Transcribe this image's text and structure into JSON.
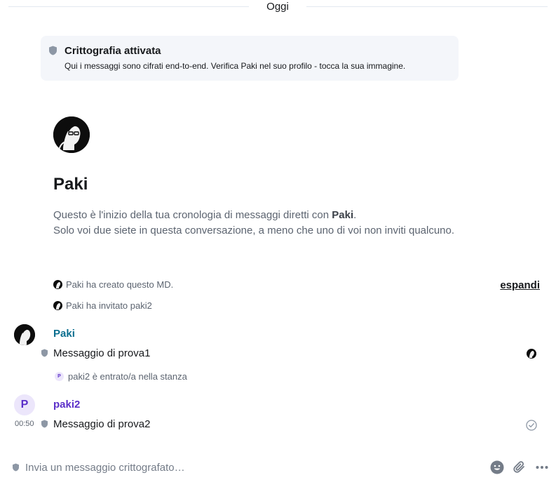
{
  "timeline": {
    "date_separator": "Oggi"
  },
  "encryption_notice": {
    "title": "Crittografia attivata",
    "description": "Qui i messaggi sono cifrati end-to-end. Verifica Paki nel suo profilo - tocca la sua immagine."
  },
  "room_intro": {
    "name": "Paki",
    "line1_prefix": "Questo è l'inizio della tua cronologia di messaggi diretti con ",
    "line1_name": "Paki",
    "line1_suffix": ".",
    "line2": "Solo voi due siete in questa conversazione, a meno che uno di voi non inviti qualcuno."
  },
  "events": {
    "created": "Paki ha creato questo MD.",
    "invited": "Paki ha invitato paki2",
    "expand_label": "espandi",
    "joined": "paki2 è entrato/a nella stanza"
  },
  "messages": [
    {
      "sender": "Paki",
      "sender_color": "#0a6e8f",
      "body": "Messaggio di prova1"
    },
    {
      "sender": "paki2",
      "avatar_letter": "P",
      "sender_color": "#5b2fc9",
      "time": "00:50",
      "body": "Messaggio di prova2"
    }
  ],
  "composer": {
    "placeholder": "Invia un messaggio crittografato…"
  },
  "icons": {
    "shield": "shield-icon",
    "emoji": "emoji-icon",
    "attachment": "paperclip-icon",
    "more": "more-options-icon",
    "read_receipt": "check-circle-icon"
  }
}
